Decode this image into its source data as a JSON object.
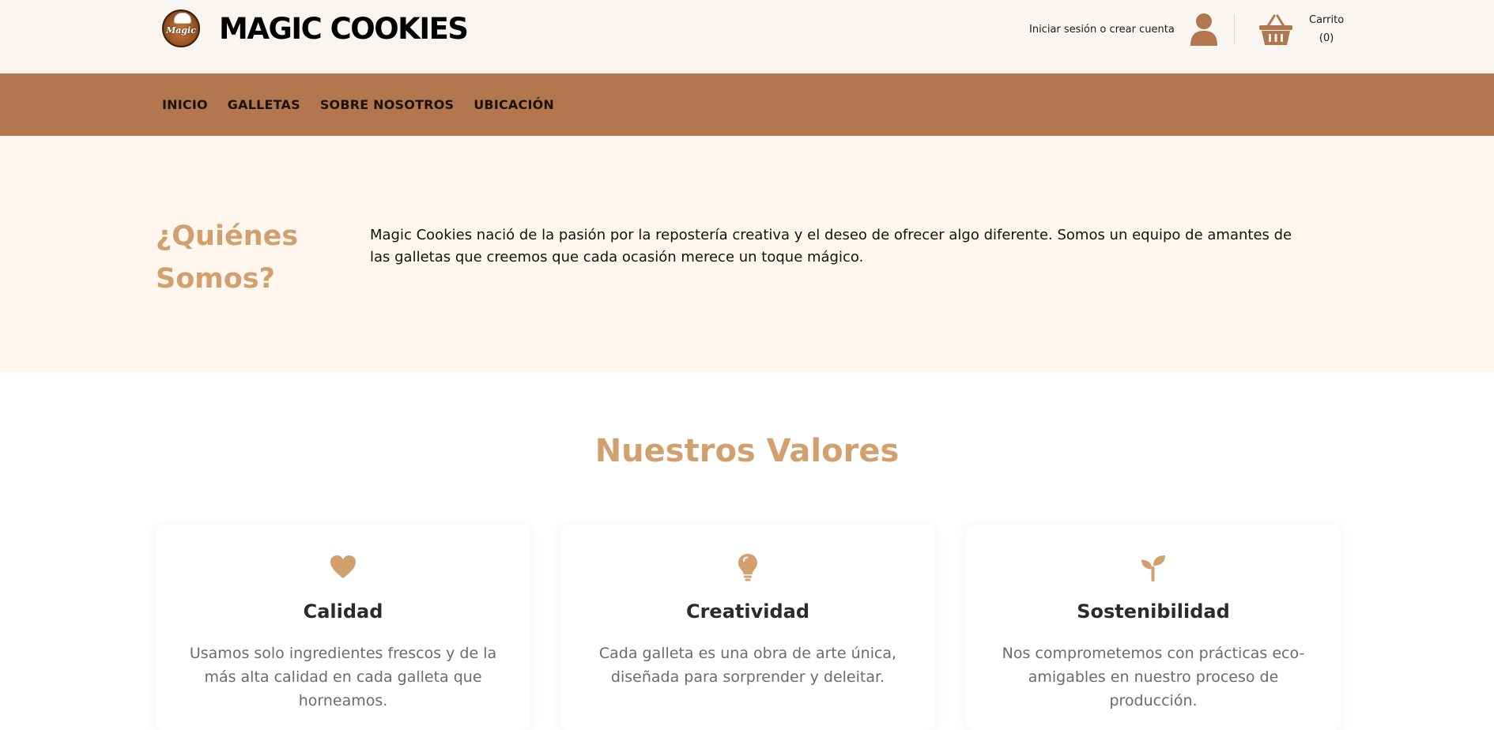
{
  "header": {
    "brand": "MAGIC COOKIES",
    "logo_script": "Magic",
    "account_label": "Iniciar sesión o crear cuenta",
    "cart_label": "Carrito",
    "cart_count": "(0)"
  },
  "nav": {
    "items": [
      {
        "label": "INICIO"
      },
      {
        "label": "GALLETAS"
      },
      {
        "label": "SOBRE NOSOTROS"
      },
      {
        "label": "UBICACIÓN"
      }
    ]
  },
  "about": {
    "title": "¿Quiénes Somos?",
    "text": "Magic Cookies nació de la pasión por la repostería creativa y el deseo de ofrecer algo diferente. Somos un equipo de amantes de las galletas que creemos que cada ocasión merece un toque mágico."
  },
  "values": {
    "title": "Nuestros Valores",
    "cards": [
      {
        "icon": "heart-icon",
        "title": "Calidad",
        "text": "Usamos solo ingredientes frescos y de la más alta calidad en cada galleta que horneamos."
      },
      {
        "icon": "lightbulb-icon",
        "title": "Creatividad",
        "text": "Cada galleta es una obra de arte única, diseñada para sorprender y deleitar."
      },
      {
        "icon": "seedling-icon",
        "title": "Sostenibilidad",
        "text": "Nos comprometemos con prácticas eco-amigables en nuestro proceso de producción."
      }
    ]
  },
  "colors": {
    "nav_bg": "#b3774f",
    "accent": "#d29f6f",
    "about_bg": "#fff7ed",
    "header_bg": "#f9f6f1"
  }
}
